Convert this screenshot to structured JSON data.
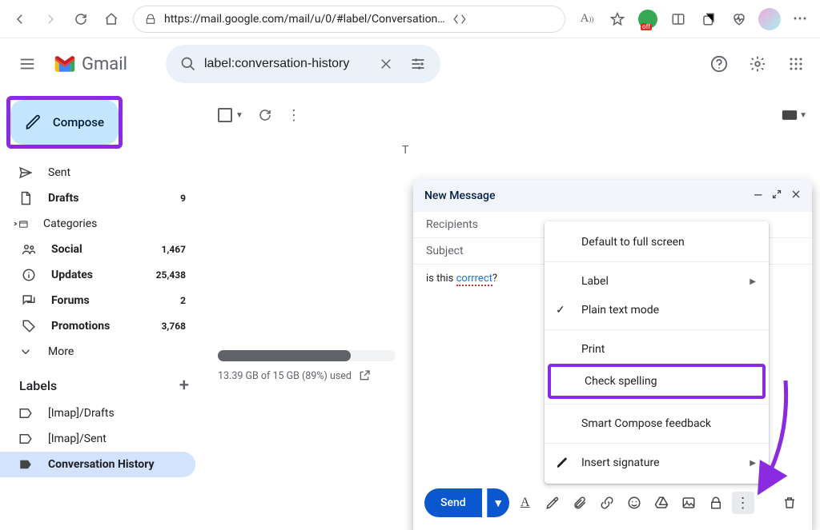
{
  "browser": {
    "url": "https://mail.google.com/mail/u/0/#label/Conversation…"
  },
  "header": {
    "logo_text": "Gmail",
    "search_value": "label:conversation-history"
  },
  "sidebar": {
    "compose_label": "Compose",
    "items": [
      {
        "label": "Sent",
        "count": "",
        "bold": false,
        "icon": "send"
      },
      {
        "label": "Drafts",
        "count": "9",
        "bold": true,
        "icon": "draft"
      },
      {
        "label": "Categories",
        "count": "",
        "bold": false,
        "icon": "category"
      }
    ],
    "categories": [
      {
        "label": "Social",
        "count": "1,467",
        "bold": true,
        "icon": "people"
      },
      {
        "label": "Updates",
        "count": "25,438",
        "bold": true,
        "icon": "info"
      },
      {
        "label": "Forums",
        "count": "2",
        "bold": true,
        "icon": "forum"
      },
      {
        "label": "Promotions",
        "count": "3,768",
        "bold": true,
        "icon": "tag"
      }
    ],
    "more_label": "More",
    "labels_header": "Labels",
    "labels": [
      {
        "label": "[Imap]/Drafts"
      },
      {
        "label": "[Imap]/Sent"
      },
      {
        "label": "Conversation History"
      }
    ]
  },
  "list": {
    "tab_letter": "T",
    "footer_usage": "13.39 GB of 15 GB (89%) used"
  },
  "compose": {
    "title": "New Message",
    "recipients_ph": "Recipients",
    "subject_ph": "Subject",
    "body_pre": "is this ",
    "body_word": "corrrect",
    "body_post": "?",
    "send_label": "Send"
  },
  "menu": {
    "default_full": "Default to full screen",
    "label": "Label",
    "plain_text": "Plain text mode",
    "print": "Print",
    "check_spelling": "Check spelling",
    "smart_feedback": "Smart Compose feedback",
    "insert_sig": "Insert signature"
  }
}
